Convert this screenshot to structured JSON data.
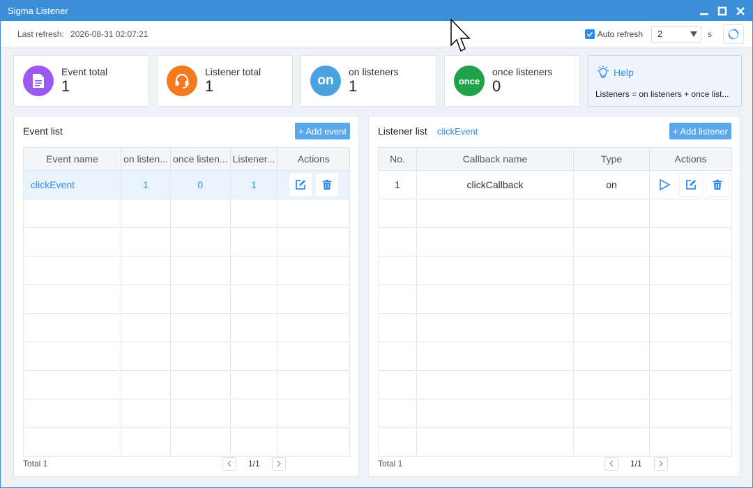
{
  "window": {
    "title": "Sigma Listener"
  },
  "toolbar": {
    "last_refresh_label": "Last refresh:",
    "last_refresh_value": "2026-08-31 02:07:21",
    "auto_refresh_label": "Auto refresh",
    "auto_refresh_checked": true,
    "interval_value": "2",
    "interval_unit": "s"
  },
  "stats": [
    {
      "label": "Event total",
      "value": "1",
      "icon": "document-icon",
      "color": "#9b59f0"
    },
    {
      "label": "Listener total",
      "value": "1",
      "icon": "headset-icon",
      "color": "#f47a20"
    },
    {
      "label": "on listeners",
      "value": "1",
      "icon_text": "on",
      "color": "#4aa3df"
    },
    {
      "label": "once listeners",
      "value": "0",
      "icon_text": "once",
      "color": "#1fa24a"
    }
  ],
  "help": {
    "title": "Help",
    "text": "Listeners = on listeners + once list...",
    "icon": "lightbulb-icon"
  },
  "event_panel": {
    "title": "Event list",
    "add_label": "+ Add event",
    "columns": [
      "Event name",
      "on listen...",
      "once listen...",
      "Listener...",
      "Actions"
    ],
    "rows": [
      {
        "name": "clickEvent",
        "on": "1",
        "once": "0",
        "total": "1"
      }
    ],
    "total_label": "Total 1",
    "page": "1/1"
  },
  "listener_panel": {
    "title": "Listener list",
    "selected_event": "clickEvent",
    "add_label": "+ Add listener",
    "columns": [
      "No.",
      "Callback name",
      "Type",
      "Actions"
    ],
    "rows": [
      {
        "no": "1",
        "callback": "clickCallback",
        "type": "on"
      }
    ],
    "total_label": "Total 1",
    "page": "1/1"
  },
  "colors": {
    "accent": "#2d8cf0",
    "titlebar": "#3b8fd8",
    "button": "#5aa7ee"
  }
}
